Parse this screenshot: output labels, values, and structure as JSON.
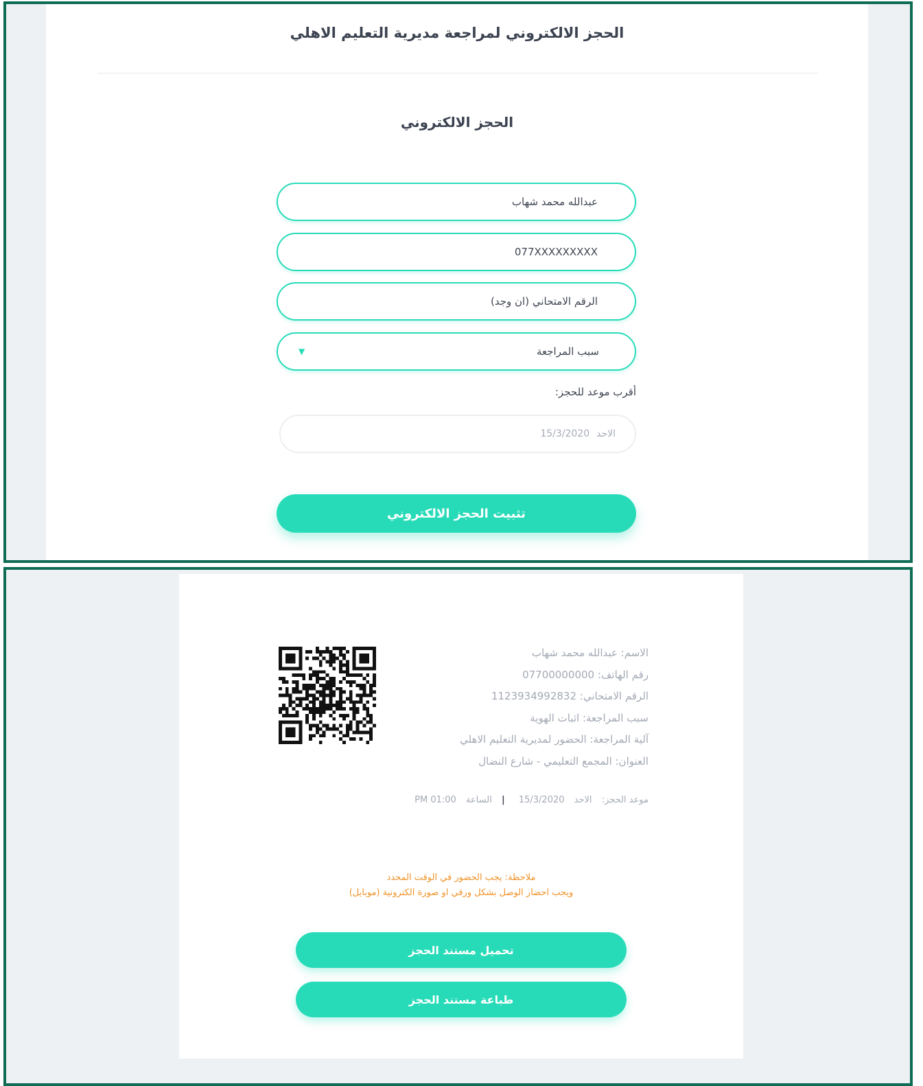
{
  "header": {
    "title": "الحجز الالكتروني لمراجعة مديرية التعليم الاهلي"
  },
  "form": {
    "title": "الحجز الالكتروني",
    "name_value": "عبدالله محمد شهاب",
    "phone_value": "077XXXXXXXXX",
    "exam_placeholder": "الرقم الامتحاني (ان وجد)",
    "reason_value": "سبب المراجعة",
    "nearest_label": "أقرب موعد للحجز:",
    "date_day": "الاحد",
    "date_value": "15/3/2020",
    "submit_label": "تثبيت الحجز الالكتروني"
  },
  "receipt": {
    "lines": [
      "الاسم: عبدالله محمد شهاب",
      "رقم الهاتف: 07700000000",
      "الرقم الامتحاني: 1123934992832",
      "سبب المراجعة: اثبات الهوية",
      "آلية المراجعة: الحضور لمديرية التعليم الاهلي",
      "العنوان: المجمع التعليمي - شارع النضال"
    ],
    "appointment_label": "موعد الحجز:",
    "appointment_day": "الاحد",
    "appointment_date": "15/3/2020",
    "appointment_separator": "|",
    "appointment_time_label": "الساعة",
    "appointment_time": "01:00 PM",
    "note_line1": "ملاحظة: يجب الحضور في الوقت المحدد",
    "note_line2": "ويجب احضار الوصل بشكل ورقي او صورة الكترونية (موبايل)",
    "download_label": "تحميل مستند الحجز",
    "print_label": "طباعة مستند الحجز"
  },
  "colors": {
    "accent": "#28dbb8",
    "frame": "#0e6b54",
    "note": "#ef9329",
    "text_dark": "#3b4250",
    "text_muted": "#a3a9b4"
  },
  "icons": {
    "select_caret": "chevron-down-icon",
    "qr": "qr-code"
  }
}
